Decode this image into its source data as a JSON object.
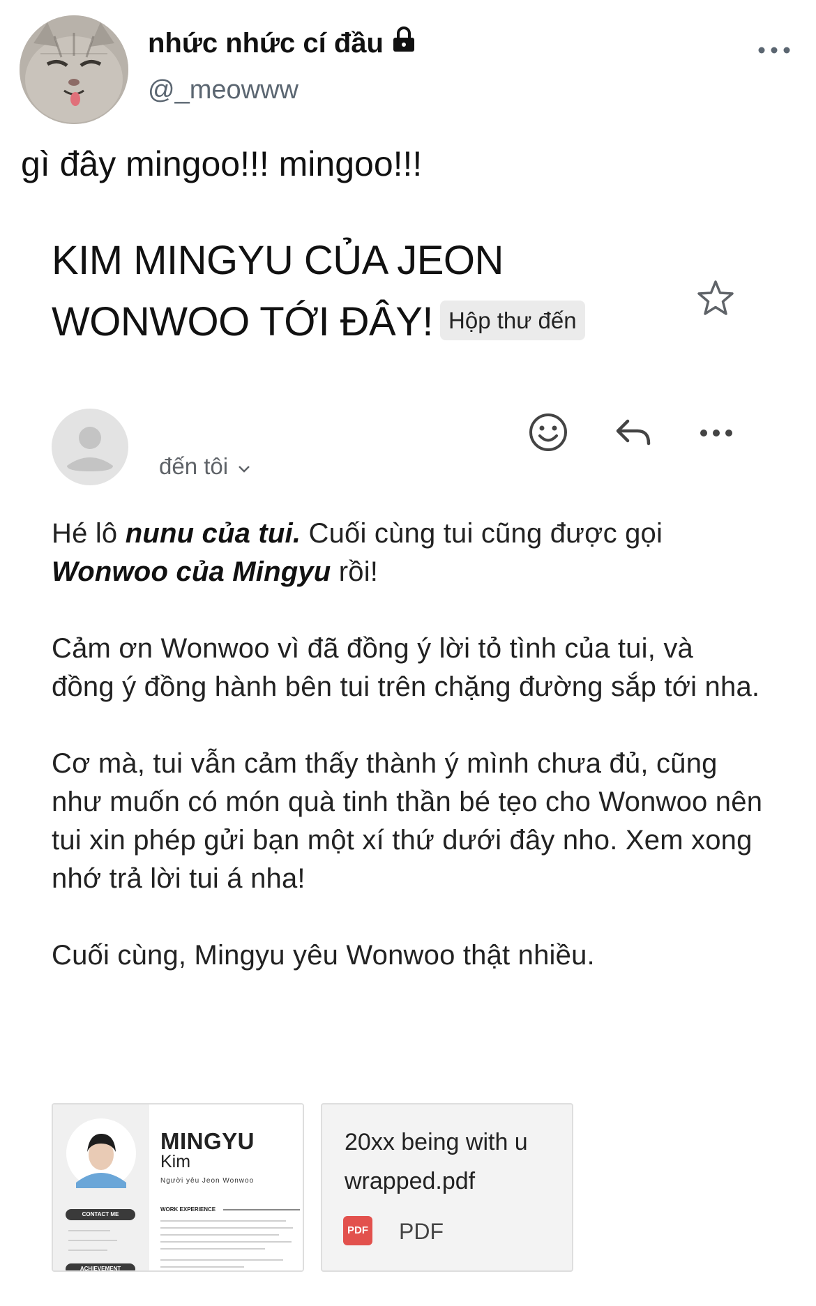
{
  "tweet": {
    "display_name": "nhức nhức cí đầu",
    "handle": "@_meowww",
    "text": "gì đây mingoo!!! mingoo!!!",
    "avatar_icon": "cat-avatar",
    "lock_icon": "lock-icon",
    "more_icon": "more-horizontal-icon"
  },
  "email": {
    "subject": "KIM MINGYU CỦA JEON WONWOO TỚI ĐÂY!",
    "badge": "Hộp thư đến",
    "recipient": "đến tôi",
    "body": {
      "p1_a": "Hé lô ",
      "p1_b": "nunu của tui.",
      "p1_c": " Cuối cùng tui cũng được gọi ",
      "p1_d": "Wonwoo của Mingyu",
      "p1_e": " rồi!",
      "p2": "Cảm ơn Wonwoo vì đã đồng ý lời tỏ tình của tui, và đồng ý đồng hành bên tui trên chặng đường sắp tới nha.",
      "p3": "Cơ mà, tui vẫn cảm thấy thành ý mình chưa đủ, cũng như muốn có món quà tinh thần bé tẹo cho Wonwoo nên tui xin phép gửi bạn một xí thứ dưới đây nho. Xem xong nhớ trả lời tui á nha!",
      "p4": "Cuối cùng, Mingyu yêu Wonwoo thật nhiều."
    }
  },
  "attachments": [
    {
      "preview": {
        "name": "MINGYU",
        "surname": "Kim",
        "subtitle": "Người yêu Jeon Wonwoo",
        "section": "WORK EXPERIENCE",
        "contact": "CONTACT ME",
        "achievement": "ACHIEVEMENT"
      }
    },
    {
      "title": "20xx being with u wrapped.pdf",
      "type_badge": "PDF",
      "type_label": "PDF"
    }
  ],
  "colors": {
    "text": "#111111",
    "muted": "#5f6368",
    "badge_bg": "#ebebeb",
    "pdf_red": "#e2514d"
  }
}
